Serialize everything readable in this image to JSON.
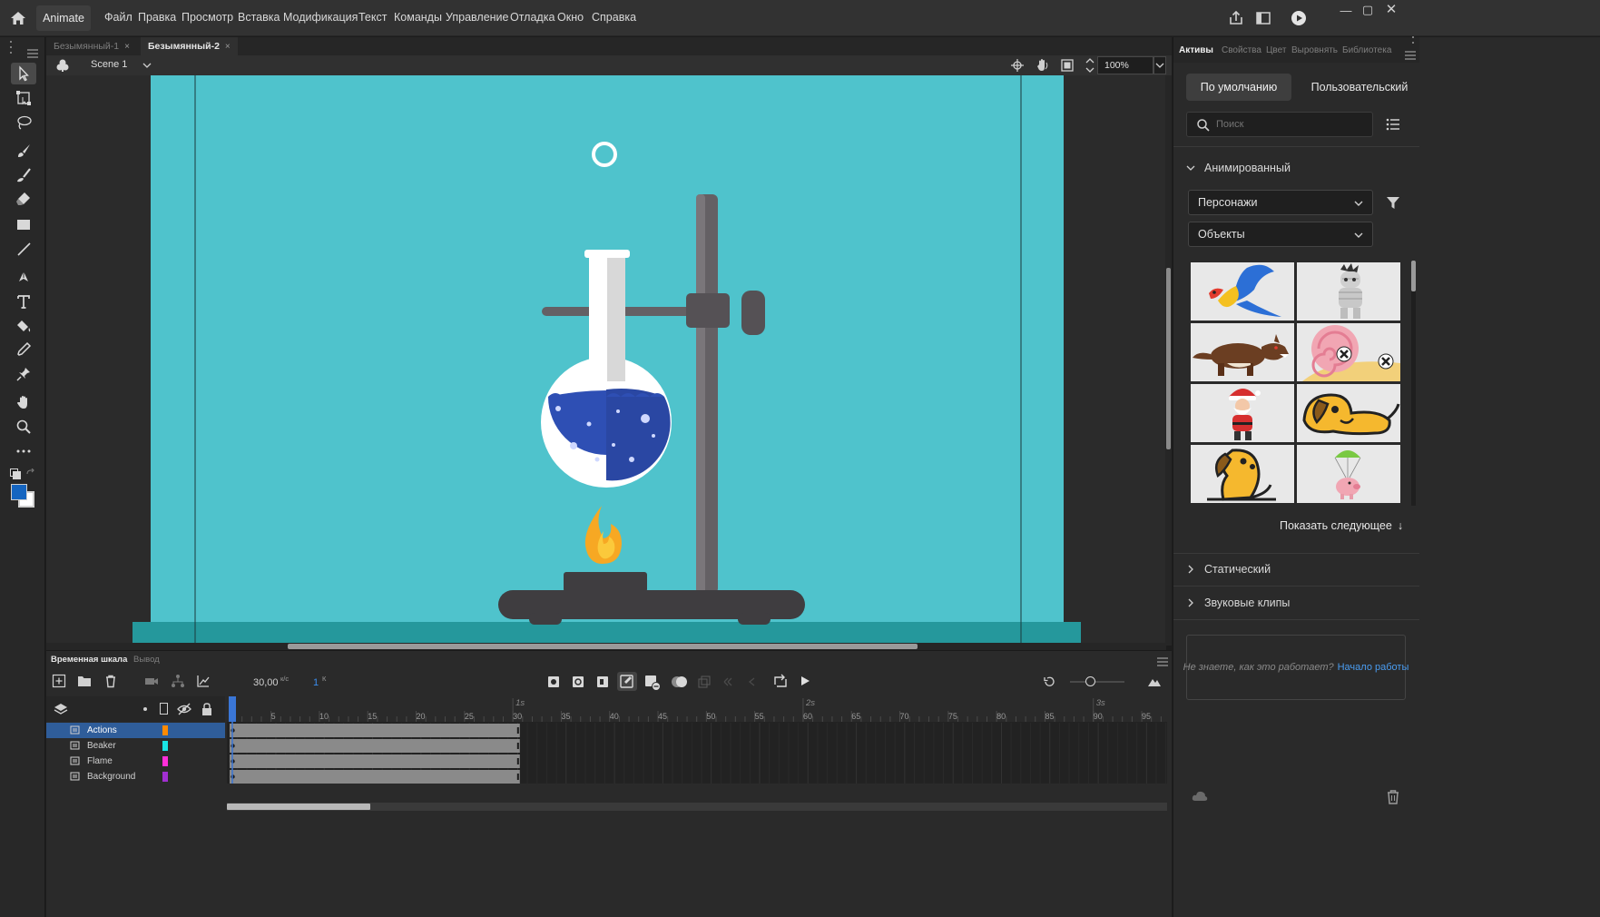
{
  "app": {
    "name": "Animate"
  },
  "menu": [
    "Файл",
    "Правка",
    "Просмотр",
    "Вставка",
    "Модификация",
    "Текст",
    "Команды",
    "Управление",
    "Отладка",
    "Окно",
    "Справка"
  ],
  "doc_tabs": [
    {
      "label": "Безымянный-1",
      "active": false
    },
    {
      "label": "Безымянный-2",
      "active": true
    }
  ],
  "stage": {
    "scene": "Scene 1",
    "zoom": "100%",
    "bg_color": "#4fc3cc"
  },
  "colors": {
    "stroke": "#1565c0",
    "fill": "#ffffff",
    "accent": "#2f80ed"
  },
  "timeline": {
    "tabs": [
      {
        "label": "Временная шкала",
        "active": true
      },
      {
        "label": "Вывод",
        "active": false
      }
    ],
    "fps": "30,00",
    "fps_unit": "к/с",
    "frame": "1",
    "frame_unit": "К",
    "seconds_marks": [
      "1s",
      "2s",
      "3s"
    ],
    "frame_numbers": [
      "5",
      "10",
      "15",
      "20",
      "25",
      "30",
      "35",
      "40",
      "45",
      "50",
      "55",
      "60",
      "65",
      "70",
      "75",
      "80",
      "85",
      "90",
      "95"
    ],
    "layers": [
      {
        "name": "Actions",
        "color": "#ff8a00",
        "selected": true
      },
      {
        "name": "Beaker",
        "color": "#19e4e4",
        "selected": false
      },
      {
        "name": "Flame",
        "color": "#ff2ed8",
        "selected": false
      },
      {
        "name": "Background",
        "color": "#a12fd1",
        "selected": false
      }
    ]
  },
  "right_panel": {
    "tabs": [
      "Активы",
      "Свойства",
      "Цвет",
      "Выровнять",
      "Библиотека"
    ],
    "active_tab": "Активы",
    "toggle_default": "По умолчанию",
    "toggle_custom": "Пользовательский",
    "search_placeholder": "Поиск",
    "section_animated": "Анимированный",
    "dropdown_category": "Персонажи",
    "dropdown_subcategory": "Объекты",
    "thumbs": [
      "parrot",
      "mummy",
      "wolf",
      "pink-snail",
      "santa",
      "dog-lying",
      "dog-sitting",
      "piggy-parachute"
    ],
    "show_more": "Показать следующее",
    "section_static": "Статический",
    "section_sounds": "Звуковые клипы",
    "help_text": "Не знаете, как это работает?",
    "help_link": "Начало работы"
  }
}
